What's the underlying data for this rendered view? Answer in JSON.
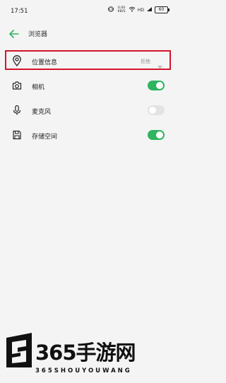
{
  "status_bar": {
    "time": "17:51",
    "speed_value": "0.00",
    "speed_unit": "KB/S",
    "network": "HD",
    "battery": "60"
  },
  "header": {
    "title": "浏览器"
  },
  "permissions": [
    {
      "label": "位置信息",
      "value": "拒绝",
      "icon": "location-pin-icon"
    },
    {
      "label": "相机",
      "toggle": "on",
      "icon": "camera-icon"
    },
    {
      "label": "麦克风",
      "toggle": "off",
      "icon": "microphone-icon"
    },
    {
      "label": "存储空间",
      "toggle": "on",
      "icon": "storage-icon"
    }
  ],
  "watermark": {
    "brand": "365手游网",
    "sub": "365SHOUYOUWANG"
  },
  "colors": {
    "accent": "#2fb45f",
    "highlight": "#d4152b",
    "toggle_off": "#e3e3e3",
    "background": "#f4f4f4"
  }
}
